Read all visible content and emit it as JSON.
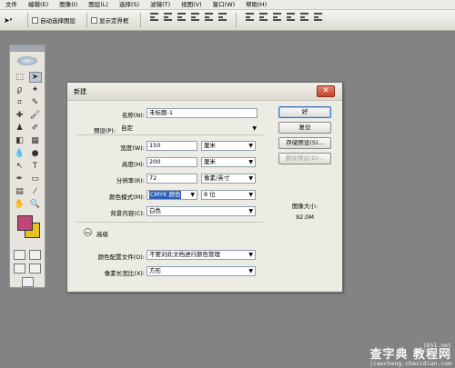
{
  "menu": [
    "文件",
    "编辑(E)",
    "图像(I)",
    "图层(L)",
    "选择(S)",
    "滤镜(T)",
    "视图(V)",
    "窗口(W)",
    "帮助(H)"
  ],
  "options": {
    "auto_select": "自动选择图层",
    "show_bounds": "显示定界框"
  },
  "dialog": {
    "title": "新建",
    "name_label": "名称(N):",
    "name_value": "未标题-1",
    "preset_label": "预设(P):",
    "preset_value": "自定",
    "width_label": "宽度(W):",
    "width_value": "150",
    "width_unit": "厘米",
    "height_label": "高度(H):",
    "height_value": "200",
    "height_unit": "厘米",
    "resolution_label": "分辨率(R):",
    "resolution_value": "72",
    "resolution_unit": "像素/英寸",
    "color_mode_label": "颜色模式(M):",
    "color_mode_value": "CMYK 颜色",
    "bit_depth": "8 位",
    "bg_label": "背景内容(C):",
    "bg_value": "白色",
    "advanced_label": "高级",
    "profile_label": "颜色配置文件(O):",
    "profile_value": "不要对此文档进行颜色管理",
    "aspect_label": "像素长宽比(X):",
    "aspect_value": "方形",
    "ok": "好",
    "reset": "复位",
    "save_preset": "存储预设(S)...",
    "delete_preset": "删除预设(D)...",
    "image_size_label": "图像大小:",
    "image_size_value": "92.0M"
  },
  "watermark": {
    "logo": "查字典 教程网",
    "site1": "jb51.net",
    "site2": "jiaocheng.chazidian.com"
  }
}
